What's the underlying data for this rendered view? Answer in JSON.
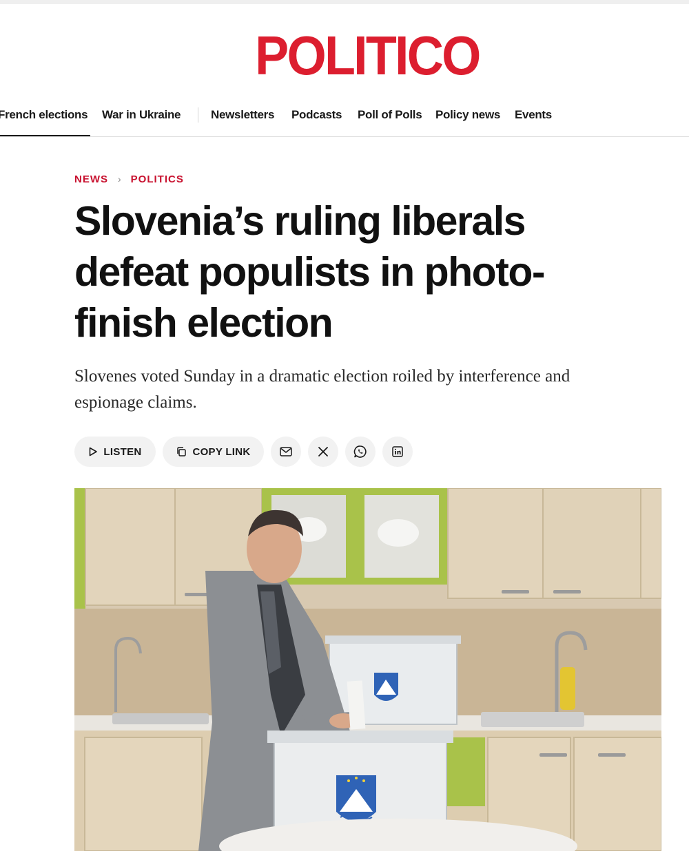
{
  "brand": {
    "logo_text": "POLITICO",
    "color": "#dc1e2f"
  },
  "nav": {
    "items": [
      {
        "label": "French elections",
        "active": true
      },
      {
        "label": "War in Ukraine"
      },
      {
        "label": "Newsletters"
      },
      {
        "label": "Podcasts"
      },
      {
        "label": "Poll of Polls"
      },
      {
        "label": "Policy news"
      },
      {
        "label": "Events"
      }
    ]
  },
  "breadcrumb": {
    "section": "NEWS",
    "subsection": "POLITICS",
    "separator": "›"
  },
  "article": {
    "headline": "Slovenia’s ruling liberals defeat populists in photo-finish election",
    "dek": "Slovenes voted Sunday in a dramatic election roiled by interference and espionage claims."
  },
  "share": {
    "listen_label": "LISTEN",
    "copy_label": "COPY LINK",
    "icons": [
      "email-icon",
      "x-icon",
      "whatsapp-icon",
      "linkedin-icon"
    ]
  },
  "image": {
    "subject": "man in grey coat casting ballot into transparent ballot box with Slovenian coat of arms in a kitchen"
  },
  "colors": {
    "accent": "#c8102e",
    "pill_bg": "#f2f2f2"
  }
}
